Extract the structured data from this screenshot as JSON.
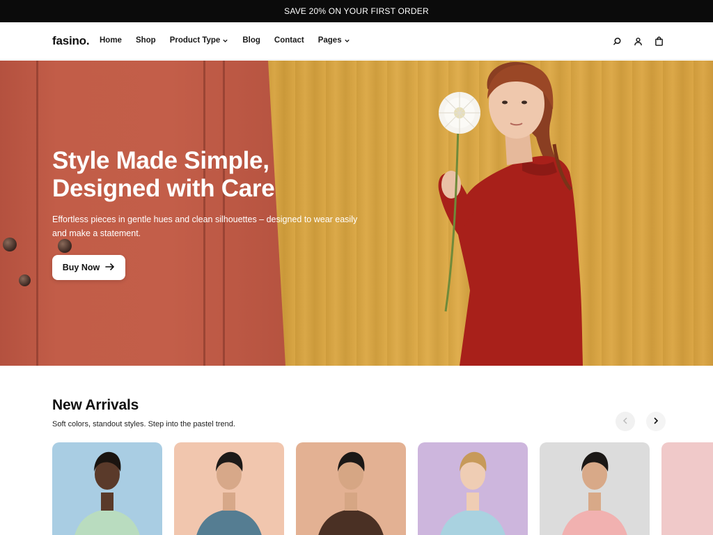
{
  "announcement": {
    "text": "SAVE 20% ON YOUR FIRST ORDER"
  },
  "header": {
    "logo": "fasino.",
    "nav": [
      {
        "label": "Home",
        "dropdown": false
      },
      {
        "label": "Shop",
        "dropdown": false
      },
      {
        "label": "Product Type",
        "dropdown": true
      },
      {
        "label": "Blog",
        "dropdown": false
      },
      {
        "label": "Contact",
        "dropdown": false
      },
      {
        "label": "Pages",
        "dropdown": true
      }
    ],
    "icons": [
      "search-icon",
      "user-icon",
      "shopping-bag-icon"
    ]
  },
  "hero": {
    "title_line1": "Style Made Simple,",
    "title_line2": "Designed with Care",
    "subtitle": "Effortless pieces in gentle hues and clean silhouettes – designed to wear easily and make a statement.",
    "button_label": "Buy Now",
    "colors": {
      "left_panel": "#c35e49",
      "right_panel": "#d9a23e",
      "dress": "#a8201a"
    }
  },
  "new_arrivals": {
    "title": "New Arrivals",
    "subtitle": "Soft colors, standout styles. Step into the pastel trend.",
    "products": [
      {
        "bg": "#a9cde3",
        "shirt": "#b9dcbf",
        "skin": "#5a3a2a",
        "hair": "#1a1410"
      },
      {
        "bg": "#f1c6ae",
        "shirt": "#557d92",
        "skin": "#d7a889",
        "hair": "#1d1a18"
      },
      {
        "bg": "#e3b193",
        "shirt": "#4a3024",
        "skin": "#d6a684",
        "hair": "#1b1816"
      },
      {
        "bg": "#cdb6dd",
        "shirt": "#a9d2e0",
        "skin": "#efcdb4",
        "hair": "#c79a5a"
      },
      {
        "bg": "#dcdcdc",
        "shirt": "#f1b1b0",
        "skin": "#d8a988",
        "hair": "#1b1816"
      }
    ]
  }
}
